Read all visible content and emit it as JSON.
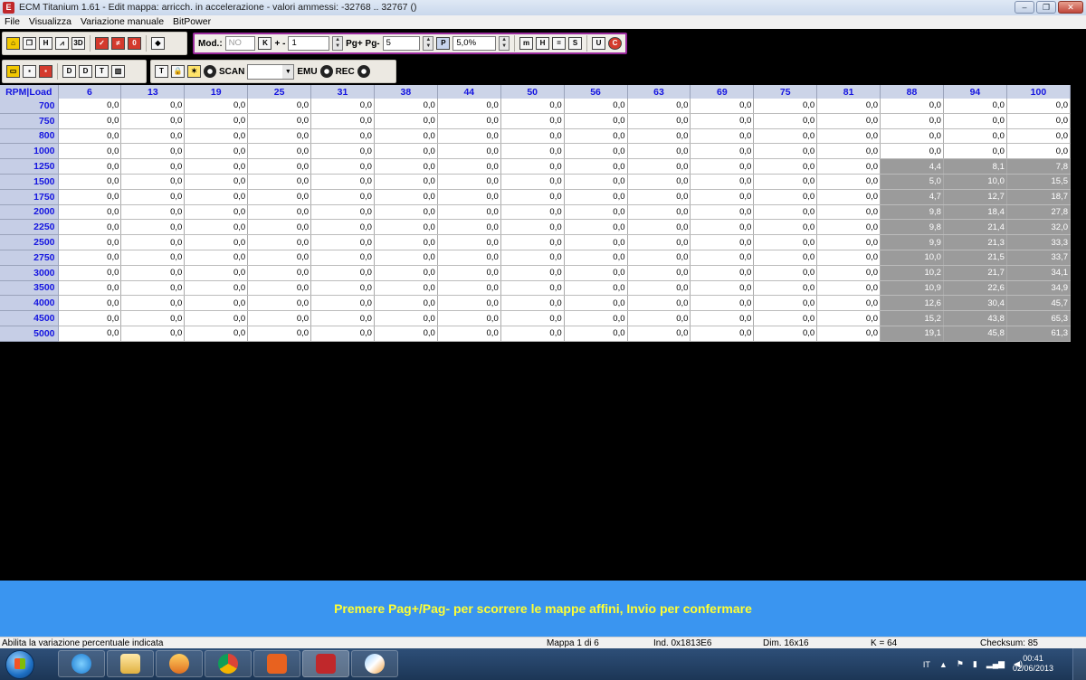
{
  "window": {
    "title": "ECM Titanium 1.61 - Edit mappa: arricch. in accelerazione - valori ammessi: -32768 .. 32767 ()",
    "controls": [
      "minimize",
      "maximize",
      "close"
    ]
  },
  "menu": [
    "File",
    "Visualizza",
    "Variazione manuale",
    "BitPower"
  ],
  "toolbar": {
    "mod_label": "Mod.:",
    "mod_value": "NO",
    "plus_minus_label": "+ -",
    "plus_minus_value": "1",
    "pg_label": "Pg+ Pg-",
    "pg_value": "5",
    "percent_value": "5,0%",
    "scan_label": "SCAN",
    "emu_label": "EMU",
    "rec_label": "REC"
  },
  "grid": {
    "corner": "RPM|Load",
    "columns": [
      "6",
      "13",
      "19",
      "25",
      "31",
      "38",
      "44",
      "50",
      "56",
      "63",
      "69",
      "75",
      "81",
      "88",
      "94",
      "100"
    ],
    "rows": [
      {
        "rpm": "700",
        "values": [
          "0,0",
          "0,0",
          "0,0",
          "0,0",
          "0,0",
          "0,0",
          "0,0",
          "0,0",
          "0,0",
          "0,0",
          "0,0",
          "0,0",
          "0,0",
          "0,0",
          "0,0",
          "0,0"
        ]
      },
      {
        "rpm": "750",
        "values": [
          "0,0",
          "0,0",
          "0,0",
          "0,0",
          "0,0",
          "0,0",
          "0,0",
          "0,0",
          "0,0",
          "0,0",
          "0,0",
          "0,0",
          "0,0",
          "0,0",
          "0,0",
          "0,0"
        ]
      },
      {
        "rpm": "800",
        "values": [
          "0,0",
          "0,0",
          "0,0",
          "0,0",
          "0,0",
          "0,0",
          "0,0",
          "0,0",
          "0,0",
          "0,0",
          "0,0",
          "0,0",
          "0,0",
          "0,0",
          "0,0",
          "0,0"
        ]
      },
      {
        "rpm": "1000",
        "values": [
          "0,0",
          "0,0",
          "0,0",
          "0,0",
          "0,0",
          "0,0",
          "0,0",
          "0,0",
          "0,0",
          "0,0",
          "0,0",
          "0,0",
          "0,0",
          "0,0",
          "0,0",
          "0,0"
        ]
      },
      {
        "rpm": "1250",
        "values": [
          "0,0",
          "0,0",
          "0,0",
          "0,0",
          "0,0",
          "0,0",
          "0,0",
          "0,0",
          "0,0",
          "0,0",
          "0,0",
          "0,0",
          "0,0",
          "4,4",
          "8,1",
          "7,8"
        ]
      },
      {
        "rpm": "1500",
        "values": [
          "0,0",
          "0,0",
          "0,0",
          "0,0",
          "0,0",
          "0,0",
          "0,0",
          "0,0",
          "0,0",
          "0,0",
          "0,0",
          "0,0",
          "0,0",
          "5,0",
          "10,0",
          "15,5"
        ]
      },
      {
        "rpm": "1750",
        "values": [
          "0,0",
          "0,0",
          "0,0",
          "0,0",
          "0,0",
          "0,0",
          "0,0",
          "0,0",
          "0,0",
          "0,0",
          "0,0",
          "0,0",
          "0,0",
          "4,7",
          "12,7",
          "18,7"
        ]
      },
      {
        "rpm": "2000",
        "values": [
          "0,0",
          "0,0",
          "0,0",
          "0,0",
          "0,0",
          "0,0",
          "0,0",
          "0,0",
          "0,0",
          "0,0",
          "0,0",
          "0,0",
          "0,0",
          "9,8",
          "18,4",
          "27,8"
        ]
      },
      {
        "rpm": "2250",
        "values": [
          "0,0",
          "0,0",
          "0,0",
          "0,0",
          "0,0",
          "0,0",
          "0,0",
          "0,0",
          "0,0",
          "0,0",
          "0,0",
          "0,0",
          "0,0",
          "9,8",
          "21,4",
          "32,0"
        ]
      },
      {
        "rpm": "2500",
        "values": [
          "0,0",
          "0,0",
          "0,0",
          "0,0",
          "0,0",
          "0,0",
          "0,0",
          "0,0",
          "0,0",
          "0,0",
          "0,0",
          "0,0",
          "0,0",
          "9,9",
          "21,3",
          "33,3"
        ]
      },
      {
        "rpm": "2750",
        "values": [
          "0,0",
          "0,0",
          "0,0",
          "0,0",
          "0,0",
          "0,0",
          "0,0",
          "0,0",
          "0,0",
          "0,0",
          "0,0",
          "0,0",
          "0,0",
          "10,0",
          "21,5",
          "33,7"
        ]
      },
      {
        "rpm": "3000",
        "values": [
          "0,0",
          "0,0",
          "0,0",
          "0,0",
          "0,0",
          "0,0",
          "0,0",
          "0,0",
          "0,0",
          "0,0",
          "0,0",
          "0,0",
          "0,0",
          "10,2",
          "21,7",
          "34,1"
        ]
      },
      {
        "rpm": "3500",
        "values": [
          "0,0",
          "0,0",
          "0,0",
          "0,0",
          "0,0",
          "0,0",
          "0,0",
          "0,0",
          "0,0",
          "0,0",
          "0,0",
          "0,0",
          "0,0",
          "10,9",
          "22,6",
          "34,9"
        ]
      },
      {
        "rpm": "4000",
        "values": [
          "0,0",
          "0,0",
          "0,0",
          "0,0",
          "0,0",
          "0,0",
          "0,0",
          "0,0",
          "0,0",
          "0,0",
          "0,0",
          "0,0",
          "0,0",
          "12,6",
          "30,4",
          "45,7"
        ]
      },
      {
        "rpm": "4500",
        "values": [
          "0,0",
          "0,0",
          "0,0",
          "0,0",
          "0,0",
          "0,0",
          "0,0",
          "0,0",
          "0,0",
          "0,0",
          "0,0",
          "0,0",
          "0,0",
          "15,2",
          "43,8",
          "65,3"
        ]
      },
      {
        "rpm": "5000",
        "values": [
          "0,0",
          "0,0",
          "0,0",
          "0,0",
          "0,0",
          "0,0",
          "0,0",
          "0,0",
          "0,0",
          "0,0",
          "0,0",
          "0,0",
          "0,0",
          "19,1",
          "45,8",
          "61,3"
        ]
      }
    ],
    "highlight_from_row": 4,
    "highlight_from_col": 13
  },
  "banner": "Premere Pag+/Pag- per scorrere le mappe affini, Invio per confermare",
  "status": {
    "hint": "Abilita la variazione percentuale indicata",
    "map": "Mappa 1 di 6",
    "ind": "Ind. 0x1813E6",
    "dim": "Dim. 16x16",
    "k": "K = 64",
    "checksum": "Checksum: 85"
  },
  "taskbar": {
    "lang": "IT",
    "time": "00:41",
    "date": "02/06/2013"
  }
}
